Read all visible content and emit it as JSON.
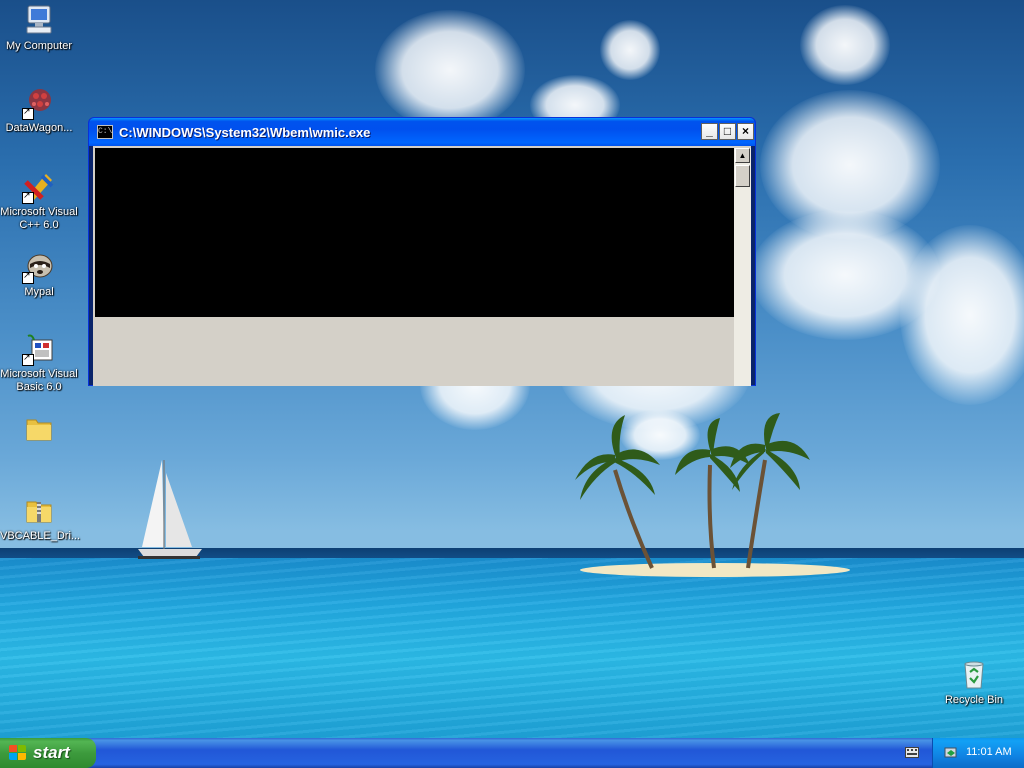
{
  "desktop": {
    "icons": [
      {
        "label": "My Computer"
      },
      {
        "label": "DataWagon..."
      },
      {
        "label": "Microsoft Visual C++ 6.0"
      },
      {
        "label": "Mypal"
      },
      {
        "label": "Microsoft Visual Basic 6.0"
      },
      {
        "label": ""
      },
      {
        "label": "VBCABLE_Dri..."
      },
      {
        "label": "Recycle Bin"
      }
    ]
  },
  "window": {
    "title": "C:\\WINDOWS\\System32\\Wbem\\wmic.exe",
    "icon_text": "C:\\",
    "minimize_label": "_",
    "maximize_label": "□",
    "close_label": "×"
  },
  "taskbar": {
    "start_label": "start",
    "clock": "11:01 AM"
  },
  "colors": {
    "console_background": "#000000",
    "titlebar_blue": "#0053ee",
    "start_green": "#3d9b3d"
  }
}
